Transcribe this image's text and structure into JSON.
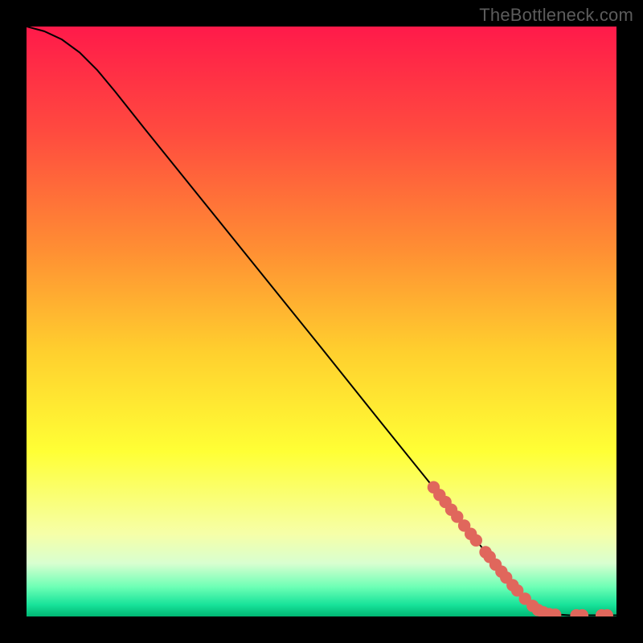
{
  "attribution": "TheBottleneck.com",
  "chart_data": {
    "type": "line",
    "title": "",
    "xlabel": "",
    "ylabel": "",
    "xlim": [
      0,
      100
    ],
    "ylim": [
      0,
      100
    ],
    "gradient_stops": [
      {
        "pct": 0,
        "color": "#ff1a4a"
      },
      {
        "pct": 18,
        "color": "#ff4b3f"
      },
      {
        "pct": 38,
        "color": "#ff8f33"
      },
      {
        "pct": 55,
        "color": "#ffcf2e"
      },
      {
        "pct": 72,
        "color": "#ffff35"
      },
      {
        "pct": 86,
        "color": "#f6ffa8"
      },
      {
        "pct": 91,
        "color": "#d8ffd0"
      },
      {
        "pct": 95,
        "color": "#6dffb5"
      },
      {
        "pct": 98,
        "color": "#18e39a"
      },
      {
        "pct": 100,
        "color": "#00b673"
      }
    ],
    "curve": [
      {
        "x": 0,
        "y": 100.0
      },
      {
        "x": 3,
        "y": 99.2
      },
      {
        "x": 6,
        "y": 97.8
      },
      {
        "x": 9,
        "y": 95.6
      },
      {
        "x": 12,
        "y": 92.6
      },
      {
        "x": 15,
        "y": 89.0
      },
      {
        "x": 20,
        "y": 82.7
      },
      {
        "x": 30,
        "y": 70.3
      },
      {
        "x": 40,
        "y": 57.9
      },
      {
        "x": 50,
        "y": 45.5
      },
      {
        "x": 60,
        "y": 33.0
      },
      {
        "x": 70,
        "y": 20.6
      },
      {
        "x": 78,
        "y": 10.7
      },
      {
        "x": 82,
        "y": 5.8
      },
      {
        "x": 85,
        "y": 2.5
      },
      {
        "x": 87,
        "y": 1.0
      },
      {
        "x": 89,
        "y": 0.4
      },
      {
        "x": 92,
        "y": 0.2
      },
      {
        "x": 96,
        "y": 0.2
      },
      {
        "x": 100,
        "y": 0.2
      }
    ],
    "markers": [
      {
        "x": 69.0,
        "y": 21.9
      },
      {
        "x": 70.0,
        "y": 20.6
      },
      {
        "x": 71.0,
        "y": 19.4
      },
      {
        "x": 72.0,
        "y": 18.1
      },
      {
        "x": 73.0,
        "y": 16.9
      },
      {
        "x": 74.2,
        "y": 15.4
      },
      {
        "x": 75.3,
        "y": 14.0
      },
      {
        "x": 76.2,
        "y": 12.9
      },
      {
        "x": 77.8,
        "y": 10.9
      },
      {
        "x": 78.5,
        "y": 10.1
      },
      {
        "x": 79.5,
        "y": 8.8
      },
      {
        "x": 80.5,
        "y": 7.6
      },
      {
        "x": 81.3,
        "y": 6.6
      },
      {
        "x": 82.4,
        "y": 5.3
      },
      {
        "x": 83.2,
        "y": 4.4
      },
      {
        "x": 84.5,
        "y": 3.0
      },
      {
        "x": 85.8,
        "y": 1.8
      },
      {
        "x": 86.7,
        "y": 1.1
      },
      {
        "x": 87.6,
        "y": 0.7
      },
      {
        "x": 88.6,
        "y": 0.4
      },
      {
        "x": 89.6,
        "y": 0.3
      },
      {
        "x": 93.2,
        "y": 0.2
      },
      {
        "x": 94.2,
        "y": 0.2
      },
      {
        "x": 97.5,
        "y": 0.2
      },
      {
        "x": 98.4,
        "y": 0.2
      }
    ],
    "marker_color": "#e0675c",
    "marker_radius_pct": 1.05,
    "line_color": "#000000"
  }
}
